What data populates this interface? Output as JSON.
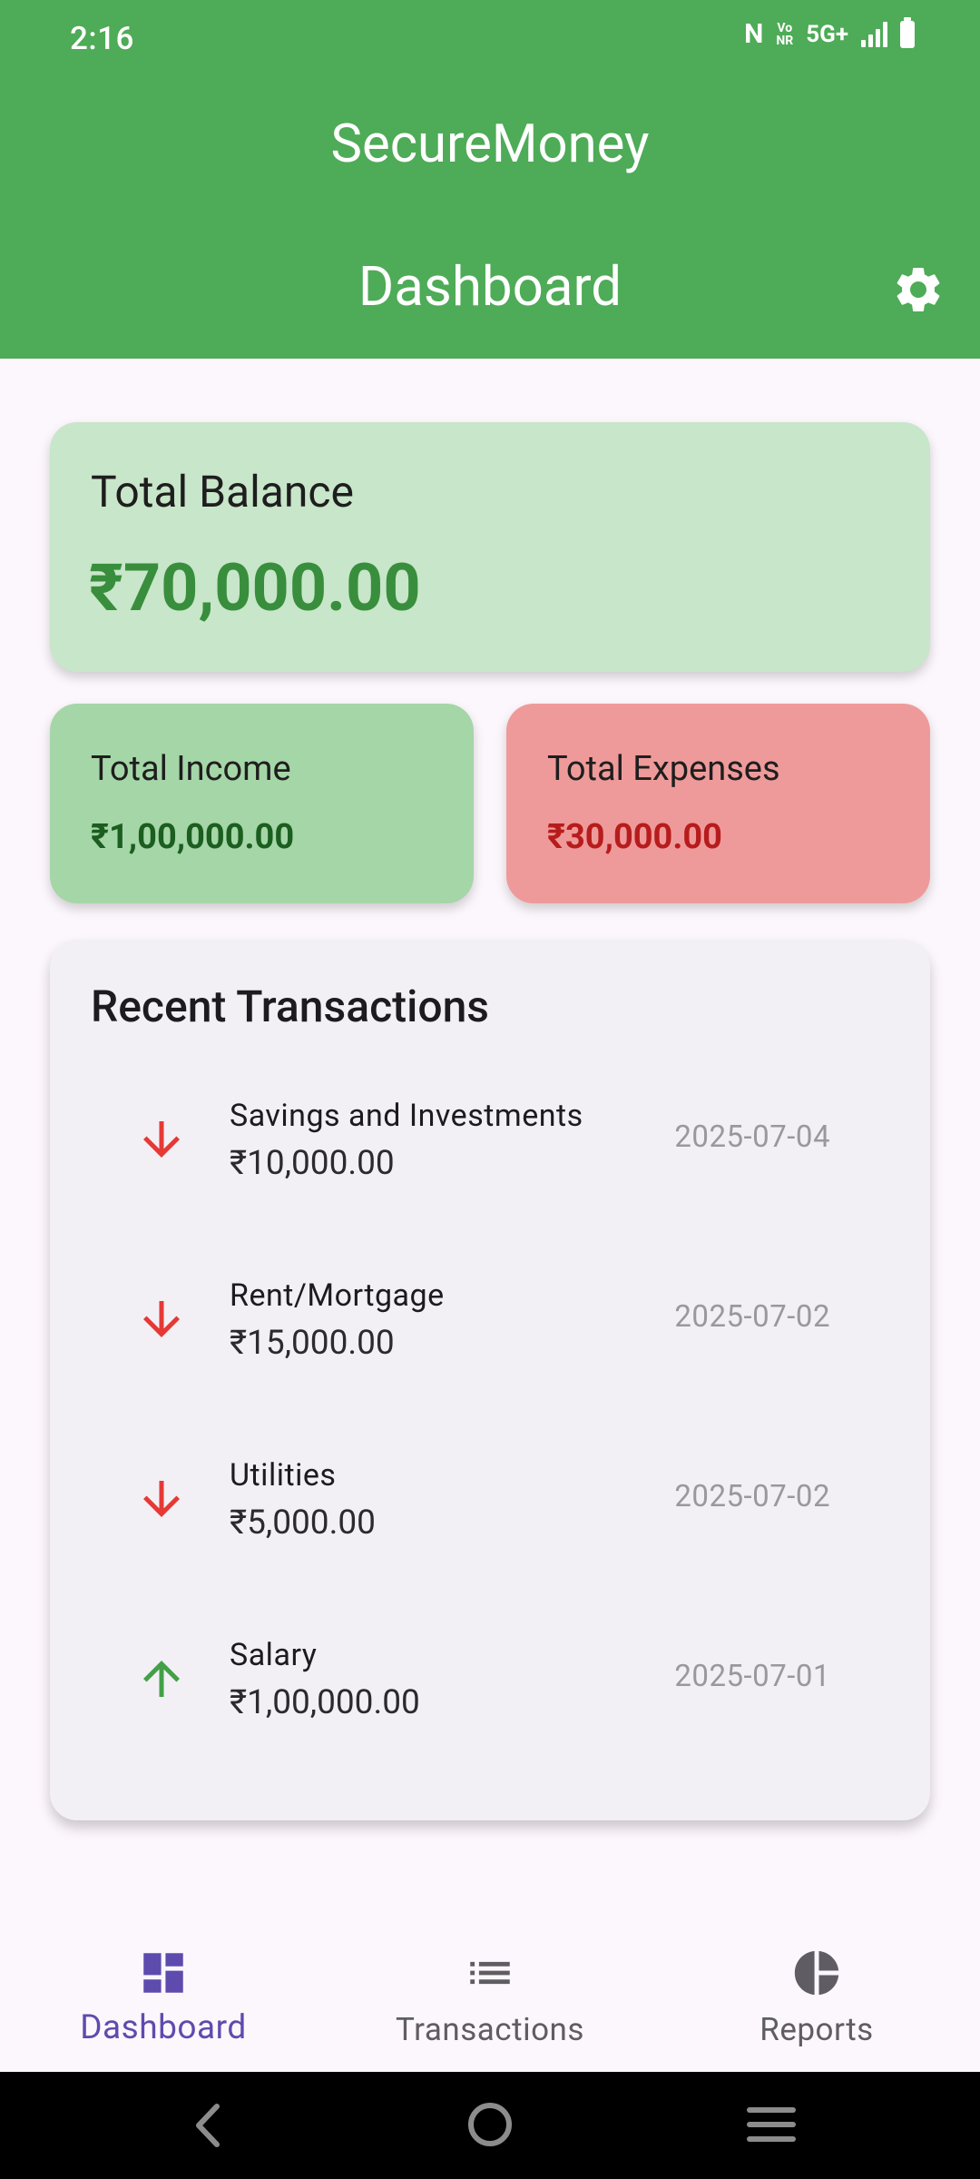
{
  "status_bar": {
    "time": "2:16",
    "nfc": "N",
    "vonr_line1": "Vo",
    "vonr_line2": "NR",
    "network": "5G+"
  },
  "appbar": {
    "app_title": "SecureMoney",
    "page_title": "Dashboard",
    "settings_icon": "gear-icon"
  },
  "balance": {
    "label": "Total Balance",
    "value": "₹70,000.00"
  },
  "income": {
    "label": "Total Income",
    "value": "₹1,00,000.00"
  },
  "expenses": {
    "label": "Total Expenses",
    "value": "₹30,000.00"
  },
  "recent": {
    "title": "Recent Transactions",
    "items": [
      {
        "name": "Savings and Investments",
        "amount": "₹10,000.00",
        "date": "2025-07-04",
        "direction": "down",
        "icon": "arrow-down-icon"
      },
      {
        "name": "Rent/Mortgage",
        "amount": "₹15,000.00",
        "date": "2025-07-02",
        "direction": "down",
        "icon": "arrow-down-icon"
      },
      {
        "name": "Utilities",
        "amount": "₹5,000.00",
        "date": "2025-07-02",
        "direction": "down",
        "icon": "arrow-down-icon"
      },
      {
        "name": "Salary",
        "amount": "₹1,00,000.00",
        "date": "2025-07-01",
        "direction": "up",
        "icon": "arrow-up-icon"
      }
    ]
  },
  "bottom_nav": {
    "items": [
      {
        "label": "Dashboard",
        "icon": "dashboard-icon",
        "active": true
      },
      {
        "label": "Transactions",
        "icon": "list-icon",
        "active": false
      },
      {
        "label": "Reports",
        "icon": "pie-chart-icon",
        "active": false
      }
    ]
  },
  "colors": {
    "appbar": "#4EAB57",
    "balance_card": "#C8E6C9",
    "income_card": "#A5D6A7",
    "expense_card": "#EF9A9A",
    "down_arrow": "#E53935",
    "up_arrow": "#43A047",
    "nav_active": "#5E4BAE"
  }
}
